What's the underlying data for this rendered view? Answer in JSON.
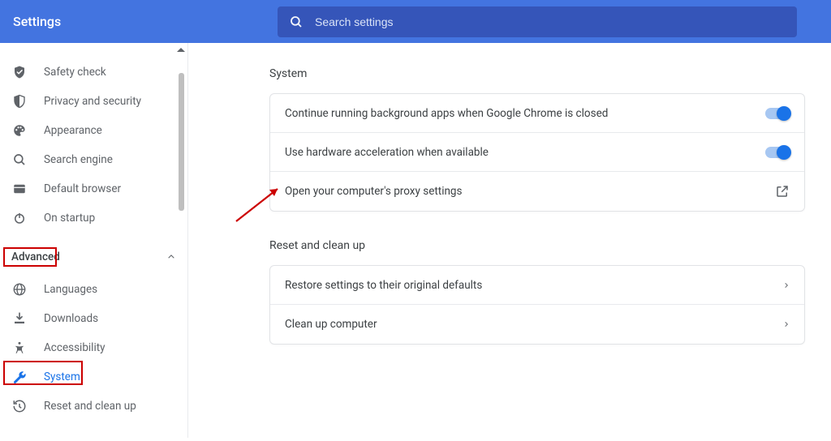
{
  "header": {
    "title": "Settings",
    "search_placeholder": "Search settings"
  },
  "sidebar": {
    "items_top": [
      {
        "icon": "shield-check",
        "label": "Safety check"
      },
      {
        "icon": "shield-half",
        "label": "Privacy and security"
      },
      {
        "icon": "palette",
        "label": "Appearance"
      },
      {
        "icon": "search",
        "label": "Search engine"
      },
      {
        "icon": "browser",
        "label": "Default browser"
      },
      {
        "icon": "power",
        "label": "On startup"
      }
    ],
    "advanced_label": "Advanced",
    "items_advanced": [
      {
        "icon": "globe",
        "label": "Languages"
      },
      {
        "icon": "download",
        "label": "Downloads"
      },
      {
        "icon": "accessibility",
        "label": "Accessibility"
      },
      {
        "icon": "wrench",
        "label": "System",
        "active": true
      },
      {
        "icon": "history",
        "label": "Reset and clean up"
      }
    ]
  },
  "main": {
    "system": {
      "title": "System",
      "rows": [
        {
          "label": "Continue running background apps when Google Chrome is closed",
          "action": "toggle-on"
        },
        {
          "label": "Use hardware acceleration when available",
          "action": "toggle-on"
        },
        {
          "label": "Open your computer's proxy settings",
          "action": "external"
        }
      ]
    },
    "reset": {
      "title": "Reset and clean up",
      "rows": [
        {
          "label": "Restore settings to their original defaults",
          "action": "chevron"
        },
        {
          "label": "Clean up computer",
          "action": "chevron"
        }
      ]
    }
  }
}
